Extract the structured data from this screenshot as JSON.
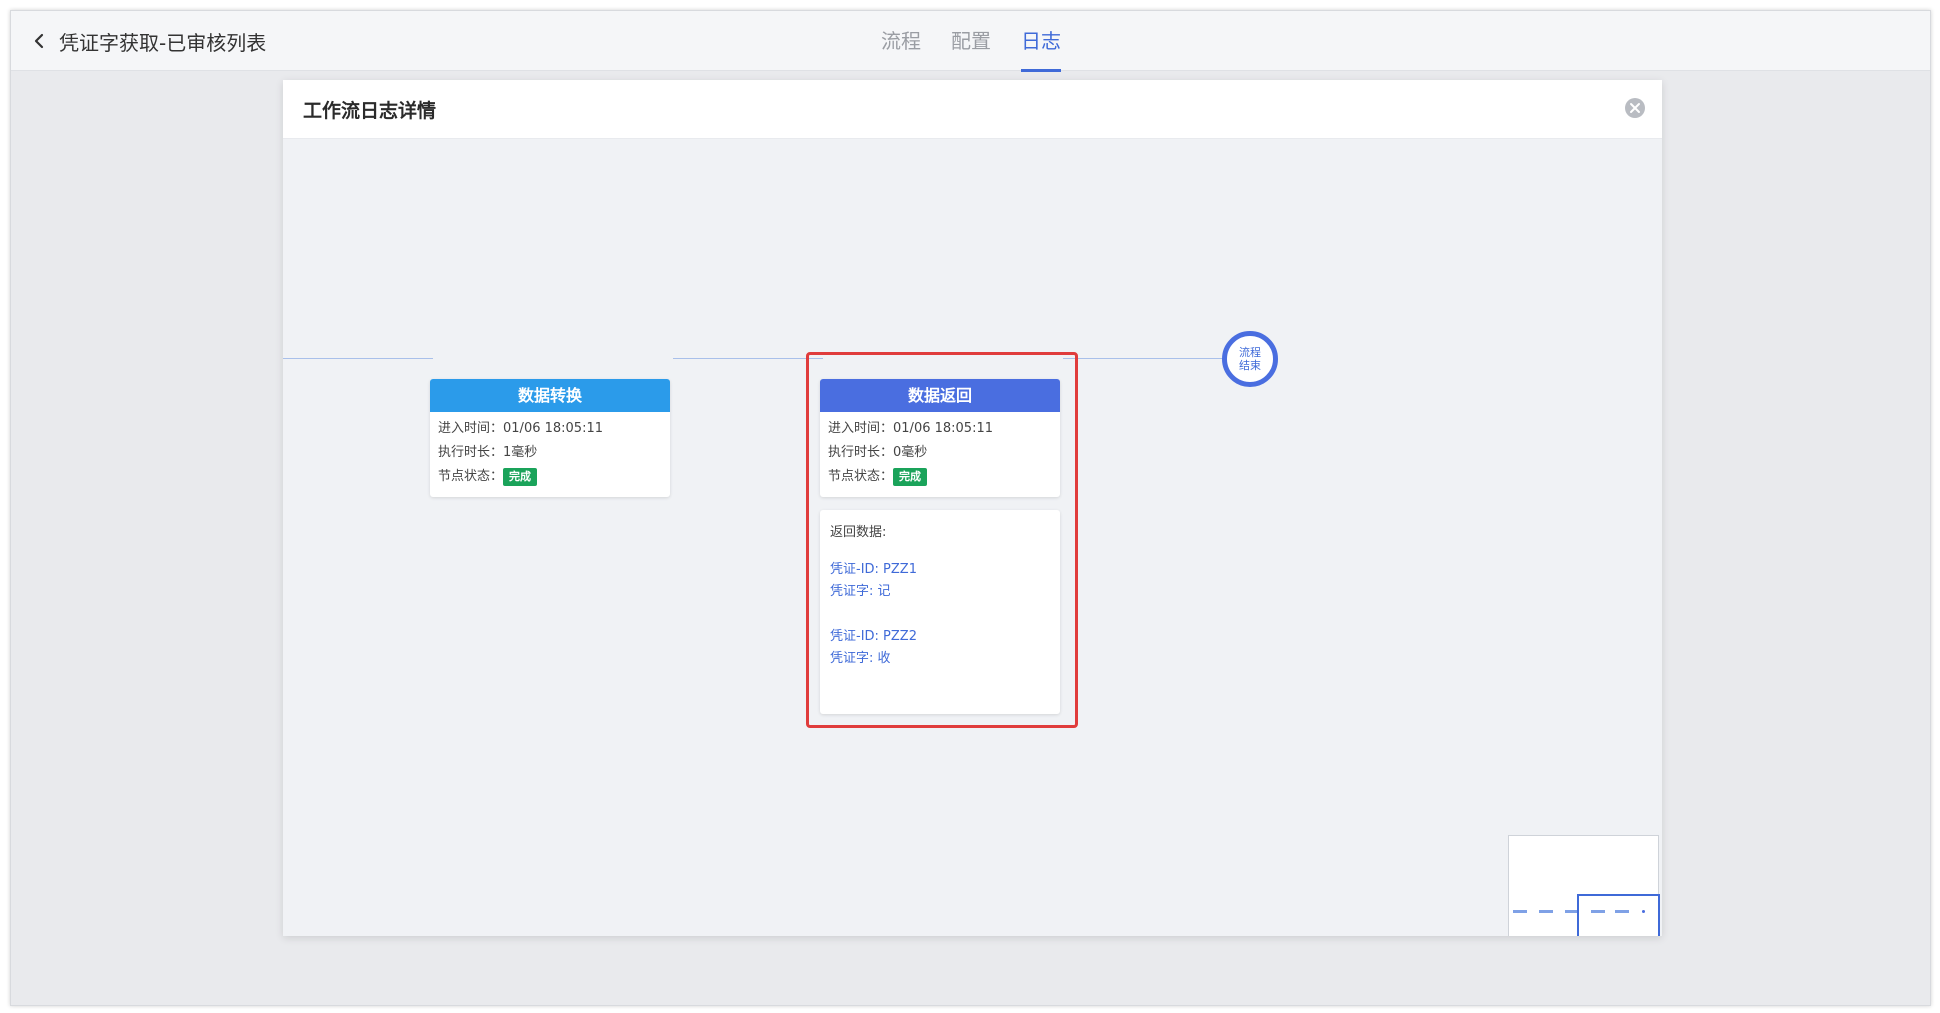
{
  "header": {
    "title": "凭证字获取-已审核列表",
    "tabs": [
      {
        "label": "流程",
        "active": false
      },
      {
        "label": "配置",
        "active": false
      },
      {
        "label": "日志",
        "active": true
      }
    ]
  },
  "dialog": {
    "title": "工作流日志详情"
  },
  "nodes": [
    {
      "name": "数据转换",
      "header_color": "#2b9bea",
      "enter_time_label": "进入时间：",
      "enter_time": "01/06 18:05:11",
      "duration_label": "执行时长：",
      "duration": "1毫秒",
      "status_label": "节点状态：",
      "status": "完成"
    },
    {
      "name": "数据返回",
      "header_color": "#4a6ee0",
      "enter_time_label": "进入时间：",
      "enter_time": "01/06 18:05:11",
      "duration_label": "执行时长：",
      "duration": "0毫秒",
      "status_label": "节点状态：",
      "status": "完成"
    }
  ],
  "return_data": {
    "label": "返回数据:",
    "records": [
      {
        "id_line": "凭证-ID: PZZ1",
        "word_line": "凭证字: 记"
      },
      {
        "id_line": "凭证-ID: PZZ2",
        "word_line": "凭证字: 收"
      }
    ]
  },
  "end_node": {
    "line1": "流程",
    "line2": "结束"
  },
  "colors": {
    "accent": "#3f6ad8",
    "status_done": "#1aa35a",
    "highlight": "#e03c3c"
  }
}
